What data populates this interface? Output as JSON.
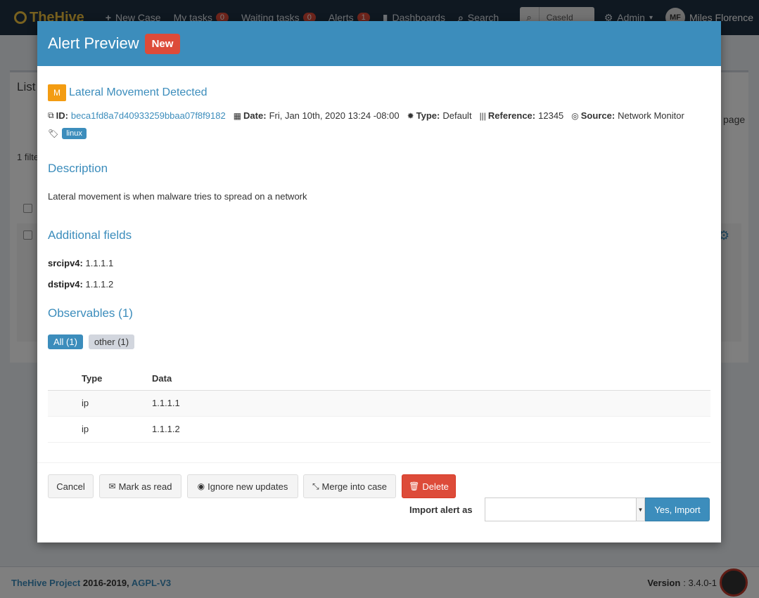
{
  "topbar": {
    "brand": "TheHive",
    "nav": {
      "new_case": "New Case",
      "my_tasks": "My tasks",
      "my_tasks_count": "0",
      "waiting_tasks": "Waiting tasks",
      "waiting_tasks_count": "0",
      "alerts": "Alerts",
      "alerts_count": "1",
      "dashboards": "Dashboards",
      "search": "Search"
    },
    "search_select": "CaseId",
    "admin": "Admin",
    "user_initials": "MF",
    "user_name": "Miles Florence"
  },
  "background": {
    "list_title": "List",
    "filter_text": "1 filte",
    "per_page": "page"
  },
  "modal": {
    "title": "Alert Preview",
    "status_badge": "New",
    "severity": "M",
    "alert_title": "Lateral Movement Detected",
    "meta": {
      "id_label": "ID:",
      "id_value": "beca1fd8a7d40933259bbaa07f8f9182",
      "date_label": "Date:",
      "date_value": "Fri, Jan 10th, 2020 13:24 -08:00",
      "type_label": "Type:",
      "type_value": "Default",
      "reference_label": "Reference:",
      "reference_value": "12345",
      "source_label": "Source:",
      "source_value": "Network Monitor"
    },
    "tags": [
      "linux"
    ],
    "description_heading": "Description",
    "description": "Lateral movement is when malware tries to spread on a network",
    "additional_heading": "Additional fields",
    "fields": [
      {
        "label": "srcipv4:",
        "value": "1.1.1.1"
      },
      {
        "label": "dstipv4:",
        "value": "1.1.1.2"
      }
    ],
    "observables_heading": "Observables (1)",
    "observable_filters": [
      "All (1)",
      "other (1)"
    ],
    "table": {
      "headers": [
        "Type",
        "Data"
      ],
      "rows": [
        {
          "type": "ip",
          "data": "1.1.1.1"
        },
        {
          "type": "ip",
          "data": "1.1.1.2"
        }
      ]
    },
    "buttons": {
      "cancel": "Cancel",
      "mark_read": "Mark as read",
      "ignore_updates": "Ignore new updates",
      "merge": "Merge into case",
      "delete": "Delete",
      "import_label": "Import alert as",
      "import_value": "",
      "confirm": "Yes, Import"
    }
  },
  "footer": {
    "project": "TheHive Project",
    "years": "2016-2019,",
    "license": "AGPL-V3",
    "version_label": "Version",
    "version": ": 3.4.0-1"
  },
  "colors": {
    "primary": "#3c8dbc",
    "danger": "#dd4b39",
    "warning": "#f39c12",
    "navbar": "#1f3042"
  }
}
